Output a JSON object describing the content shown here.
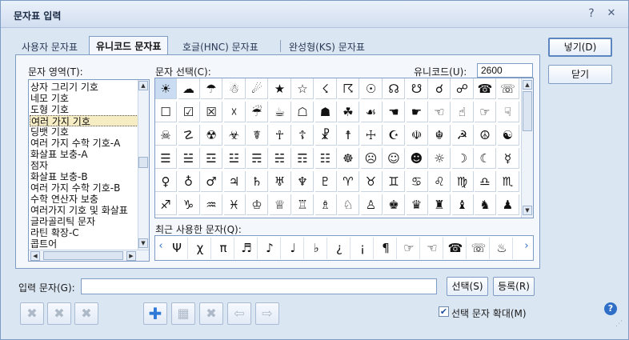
{
  "window": {
    "title": "문자표 입력",
    "help_glyph": "?",
    "close_glyph": "✕"
  },
  "tabs": [
    {
      "label": "사용자 문자표",
      "active": false
    },
    {
      "label": "유니코드 문자표",
      "active": true
    },
    {
      "label": "호글(HNC) 문자표",
      "active": false
    },
    {
      "label": "완성형(KS) 문자표",
      "active": false
    }
  ],
  "area": {
    "label": "문자 영역(T):",
    "items": [
      "상자 그리기 기호",
      "네모 기호",
      "도형 기호",
      "여러 가지 기호",
      "딩뱃 기호",
      "여러 가지 수학 기호-A",
      "화살표 보충-A",
      "점자",
      "화살표 보충-B",
      "여러 가지 수학 기호-B",
      "수학 연산자 보충",
      "여러가지 기호 및 화살표",
      "글라골리틱 문자",
      "라틴 확장-C",
      "콥트어"
    ],
    "selected_index": 3
  },
  "selection": {
    "label": "문자 선택(C):",
    "code_label": "유니코드(U):",
    "code_value": "2600",
    "rows": [
      [
        "☀",
        "☁",
        "☂",
        "☃",
        "☄",
        "★",
        "☆",
        "☇",
        "☈",
        "☉",
        "☊",
        "☋",
        "☌",
        "☍",
        "☎",
        "☏"
      ],
      [
        "☐",
        "☑",
        "☒",
        "☓",
        "☔",
        "☕",
        "☖",
        "☗",
        "☘",
        "☙",
        "☚",
        "☛",
        "☜",
        "☝",
        "☞",
        "☟"
      ],
      [
        "☠",
        "☡",
        "☢",
        "☣",
        "☤",
        "☥",
        "☦",
        "☧",
        "☨",
        "☩",
        "☪",
        "☫",
        "☬",
        "☭",
        "☮",
        "☯"
      ],
      [
        "☰",
        "☱",
        "☲",
        "☳",
        "☴",
        "☵",
        "☶",
        "☷",
        "☸",
        "☹",
        "☺",
        "☻",
        "☼",
        "☽",
        "☾",
        "☿"
      ],
      [
        "♀",
        "♁",
        "♂",
        "♃",
        "♄",
        "♅",
        "♆",
        "♇",
        "♈",
        "♉",
        "♊",
        "♋",
        "♌",
        "♍",
        "♎",
        "♏"
      ],
      [
        "♐",
        "♑",
        "♒",
        "♓",
        "♔",
        "♕",
        "♖",
        "♗",
        "♘",
        "♙",
        "♚",
        "♛",
        "♜",
        "♝",
        "♞",
        "♟"
      ]
    ],
    "selected_symbol": "☀"
  },
  "recent": {
    "label": "최근 사용한 문자(Q):",
    "items": [
      "Ψ",
      "χ",
      "π",
      "♬",
      "♪",
      "♩",
      "♭",
      "¿",
      "¡",
      "¶",
      "☞",
      "☜",
      "☎",
      "☏",
      "♨"
    ],
    "prev_glyph": "‹",
    "next_glyph": "›"
  },
  "input": {
    "label": "입력 문자(G):",
    "value": ""
  },
  "buttons": {
    "insert": "넣기(D)",
    "close": "닫기",
    "select": "선택(S)",
    "register": "등록(R)"
  },
  "checkbox": {
    "label": "선택 문자 확대(M)",
    "checked": true,
    "mark": "✔"
  },
  "toolbar": {
    "icons": [
      "✖",
      "✖",
      "✖",
      "✚",
      "▦",
      "✖",
      "⇦",
      "⇨"
    ]
  }
}
